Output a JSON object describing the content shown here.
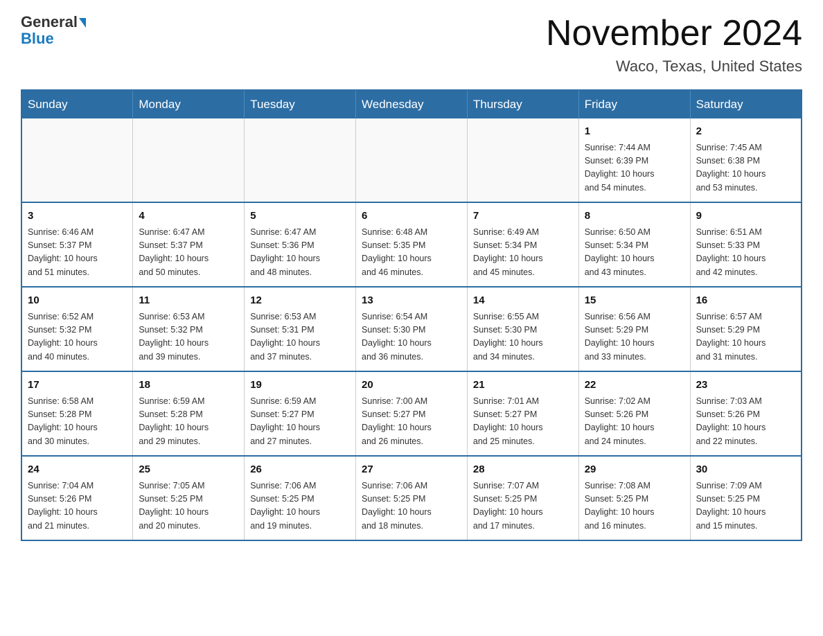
{
  "logo": {
    "text_general": "General",
    "text_blue": "Blue",
    "triangle_color": "#1a7abf"
  },
  "header": {
    "month_title": "November 2024",
    "location": "Waco, Texas, United States"
  },
  "weekdays": [
    "Sunday",
    "Monday",
    "Tuesday",
    "Wednesday",
    "Thursday",
    "Friday",
    "Saturday"
  ],
  "weeks": [
    [
      {
        "day": "",
        "info": ""
      },
      {
        "day": "",
        "info": ""
      },
      {
        "day": "",
        "info": ""
      },
      {
        "day": "",
        "info": ""
      },
      {
        "day": "",
        "info": ""
      },
      {
        "day": "1",
        "info": "Sunrise: 7:44 AM\nSunset: 6:39 PM\nDaylight: 10 hours\nand 54 minutes."
      },
      {
        "day": "2",
        "info": "Sunrise: 7:45 AM\nSunset: 6:38 PM\nDaylight: 10 hours\nand 53 minutes."
      }
    ],
    [
      {
        "day": "3",
        "info": "Sunrise: 6:46 AM\nSunset: 5:37 PM\nDaylight: 10 hours\nand 51 minutes."
      },
      {
        "day": "4",
        "info": "Sunrise: 6:47 AM\nSunset: 5:37 PM\nDaylight: 10 hours\nand 50 minutes."
      },
      {
        "day": "5",
        "info": "Sunrise: 6:47 AM\nSunset: 5:36 PM\nDaylight: 10 hours\nand 48 minutes."
      },
      {
        "day": "6",
        "info": "Sunrise: 6:48 AM\nSunset: 5:35 PM\nDaylight: 10 hours\nand 46 minutes."
      },
      {
        "day": "7",
        "info": "Sunrise: 6:49 AM\nSunset: 5:34 PM\nDaylight: 10 hours\nand 45 minutes."
      },
      {
        "day": "8",
        "info": "Sunrise: 6:50 AM\nSunset: 5:34 PM\nDaylight: 10 hours\nand 43 minutes."
      },
      {
        "day": "9",
        "info": "Sunrise: 6:51 AM\nSunset: 5:33 PM\nDaylight: 10 hours\nand 42 minutes."
      }
    ],
    [
      {
        "day": "10",
        "info": "Sunrise: 6:52 AM\nSunset: 5:32 PM\nDaylight: 10 hours\nand 40 minutes."
      },
      {
        "day": "11",
        "info": "Sunrise: 6:53 AM\nSunset: 5:32 PM\nDaylight: 10 hours\nand 39 minutes."
      },
      {
        "day": "12",
        "info": "Sunrise: 6:53 AM\nSunset: 5:31 PM\nDaylight: 10 hours\nand 37 minutes."
      },
      {
        "day": "13",
        "info": "Sunrise: 6:54 AM\nSunset: 5:30 PM\nDaylight: 10 hours\nand 36 minutes."
      },
      {
        "day": "14",
        "info": "Sunrise: 6:55 AM\nSunset: 5:30 PM\nDaylight: 10 hours\nand 34 minutes."
      },
      {
        "day": "15",
        "info": "Sunrise: 6:56 AM\nSunset: 5:29 PM\nDaylight: 10 hours\nand 33 minutes."
      },
      {
        "day": "16",
        "info": "Sunrise: 6:57 AM\nSunset: 5:29 PM\nDaylight: 10 hours\nand 31 minutes."
      }
    ],
    [
      {
        "day": "17",
        "info": "Sunrise: 6:58 AM\nSunset: 5:28 PM\nDaylight: 10 hours\nand 30 minutes."
      },
      {
        "day": "18",
        "info": "Sunrise: 6:59 AM\nSunset: 5:28 PM\nDaylight: 10 hours\nand 29 minutes."
      },
      {
        "day": "19",
        "info": "Sunrise: 6:59 AM\nSunset: 5:27 PM\nDaylight: 10 hours\nand 27 minutes."
      },
      {
        "day": "20",
        "info": "Sunrise: 7:00 AM\nSunset: 5:27 PM\nDaylight: 10 hours\nand 26 minutes."
      },
      {
        "day": "21",
        "info": "Sunrise: 7:01 AM\nSunset: 5:27 PM\nDaylight: 10 hours\nand 25 minutes."
      },
      {
        "day": "22",
        "info": "Sunrise: 7:02 AM\nSunset: 5:26 PM\nDaylight: 10 hours\nand 24 minutes."
      },
      {
        "day": "23",
        "info": "Sunrise: 7:03 AM\nSunset: 5:26 PM\nDaylight: 10 hours\nand 22 minutes."
      }
    ],
    [
      {
        "day": "24",
        "info": "Sunrise: 7:04 AM\nSunset: 5:26 PM\nDaylight: 10 hours\nand 21 minutes."
      },
      {
        "day": "25",
        "info": "Sunrise: 7:05 AM\nSunset: 5:25 PM\nDaylight: 10 hours\nand 20 minutes."
      },
      {
        "day": "26",
        "info": "Sunrise: 7:06 AM\nSunset: 5:25 PM\nDaylight: 10 hours\nand 19 minutes."
      },
      {
        "day": "27",
        "info": "Sunrise: 7:06 AM\nSunset: 5:25 PM\nDaylight: 10 hours\nand 18 minutes."
      },
      {
        "day": "28",
        "info": "Sunrise: 7:07 AM\nSunset: 5:25 PM\nDaylight: 10 hours\nand 17 minutes."
      },
      {
        "day": "29",
        "info": "Sunrise: 7:08 AM\nSunset: 5:25 PM\nDaylight: 10 hours\nand 16 minutes."
      },
      {
        "day": "30",
        "info": "Sunrise: 7:09 AM\nSunset: 5:25 PM\nDaylight: 10 hours\nand 15 minutes."
      }
    ]
  ]
}
